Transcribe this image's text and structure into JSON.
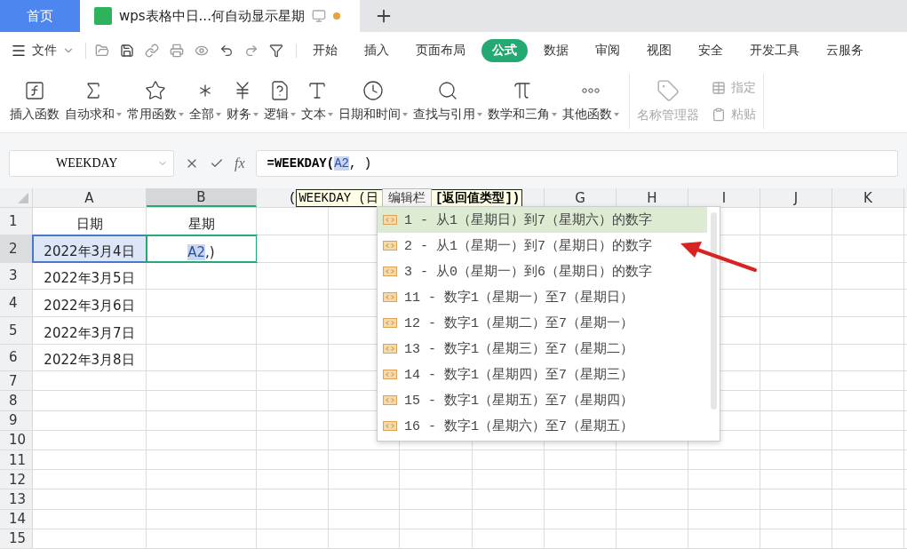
{
  "tabs": [
    {
      "label": "首页",
      "kind": "home",
      "selected": false
    },
    {
      "label": "wps表格中日...何自动显示星期",
      "kind": "doc",
      "selected": true,
      "unsaved": true
    }
  ],
  "menu": {
    "file": "文件",
    "items": [
      {
        "label": "开始",
        "selected": false
      },
      {
        "label": "插入",
        "selected": false
      },
      {
        "label": "页面布局",
        "selected": false
      },
      {
        "label": "公式",
        "selected": true
      },
      {
        "label": "数据",
        "selected": false
      },
      {
        "label": "审阅",
        "selected": false
      },
      {
        "label": "视图",
        "selected": false
      },
      {
        "label": "安全",
        "selected": false
      },
      {
        "label": "开发工具",
        "selected": false
      },
      {
        "label": "云服务",
        "selected": false
      }
    ]
  },
  "ribbon": [
    {
      "label": "插入函数",
      "dropdown": false
    },
    {
      "label": "自动求和",
      "dropdown": true
    },
    {
      "label": "常用函数",
      "dropdown": true
    },
    {
      "label": "全部",
      "dropdown": true
    },
    {
      "label": "财务",
      "dropdown": true
    },
    {
      "label": "逻辑",
      "dropdown": true
    },
    {
      "label": "文本",
      "dropdown": true
    },
    {
      "label": "日期和时间",
      "dropdown": true
    },
    {
      "label": "查找与引用",
      "dropdown": true
    },
    {
      "label": "数学和三角",
      "dropdown": true
    },
    {
      "label": "其他函数",
      "dropdown": true
    }
  ],
  "ribbon_disabled": {
    "name_manager": "名称管理器",
    "assign": "指定",
    "paste": "粘贴"
  },
  "formula_bar": {
    "name_box": "WEEKDAY",
    "fx": "fx",
    "func": "=WEEKDAY(",
    "ref": "A2",
    "rest": ", )"
  },
  "columns": [
    {
      "label": "A",
      "selected": false
    },
    {
      "label": "B",
      "selected": true
    },
    {
      "label": "G",
      "selected": false
    },
    {
      "label": "H",
      "selected": false
    },
    {
      "label": "I",
      "selected": false
    },
    {
      "label": "J",
      "selected": false
    },
    {
      "label": "K",
      "selected": false
    }
  ],
  "rows": [
    {
      "num": "1",
      "selected": false,
      "a": "日期",
      "b": "星期"
    },
    {
      "num": "2",
      "selected": true,
      "a": "2022年3月4日"
    },
    {
      "num": "3",
      "selected": false,
      "a": "2022年3月5日"
    },
    {
      "num": "4",
      "selected": false,
      "a": "2022年3月6日"
    },
    {
      "num": "5",
      "selected": false,
      "a": "2022年3月7日"
    },
    {
      "num": "6",
      "selected": false,
      "a": "2022年3月8日"
    },
    {
      "num": "7",
      "selected": false
    },
    {
      "num": "8",
      "selected": false
    },
    {
      "num": "9",
      "selected": false
    },
    {
      "num": "10",
      "selected": false
    },
    {
      "num": "11",
      "selected": false
    },
    {
      "num": "12",
      "selected": false
    },
    {
      "num": "13",
      "selected": false
    },
    {
      "num": "14",
      "selected": false
    },
    {
      "num": "15",
      "selected": false
    }
  ],
  "edit_cell": {
    "ref": "A2",
    "rest": ",)"
  },
  "signature_tip": {
    "open": "(",
    "args": "WEEKDAY (日",
    "hover_label": "编辑栏",
    "current": "[返回值类型])"
  },
  "suggestions": [
    {
      "label": "1 - 从1（星期日）到7（星期六）的数字",
      "selected": true
    },
    {
      "label": "2 - 从1（星期一）到7（星期日）的数字",
      "selected": false
    },
    {
      "label": "3 - 从0（星期一）到6（星期日）的数字",
      "selected": false
    },
    {
      "label": "11 - 数字1（星期一）至7（星期日）",
      "selected": false
    },
    {
      "label": "12 - 数字1（星期二）至7（星期一）",
      "selected": false
    },
    {
      "label": "13 - 数字1（星期三）至7（星期二）",
      "selected": false
    },
    {
      "label": "14 - 数字1（星期四）至7（星期三）",
      "selected": false
    },
    {
      "label": "15 - 数字1（星期五）至7（星期四）",
      "selected": false
    },
    {
      "label": "16 - 数字1（星期六）至7（星期五）",
      "selected": false
    }
  ]
}
